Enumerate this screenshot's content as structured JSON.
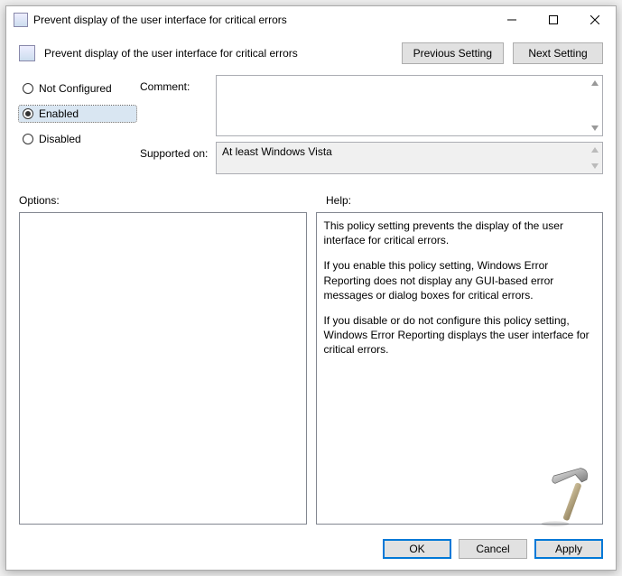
{
  "window": {
    "title": "Prevent display of the user interface for critical errors"
  },
  "header": {
    "title": "Prevent display of the user interface for critical errors",
    "prev": "Previous Setting",
    "next": "Next Setting"
  },
  "radios": {
    "not_configured": "Not Configured",
    "enabled": "Enabled",
    "disabled": "Disabled",
    "selected": "enabled"
  },
  "labels": {
    "comment": "Comment:",
    "supported": "Supported on:",
    "options": "Options:",
    "help": "Help:"
  },
  "supported_text": "At least Windows Vista",
  "comment_text": "",
  "help": {
    "p1": "This policy setting prevents the display of the user interface for critical errors.",
    "p2": "If you enable this policy setting, Windows Error Reporting does not display any GUI-based error messages or dialog boxes for critical errors.",
    "p3": "If you disable or do not configure this policy setting, Windows Error Reporting displays the user interface for critical errors."
  },
  "footer": {
    "ok": "OK",
    "cancel": "Cancel",
    "apply": "Apply"
  }
}
